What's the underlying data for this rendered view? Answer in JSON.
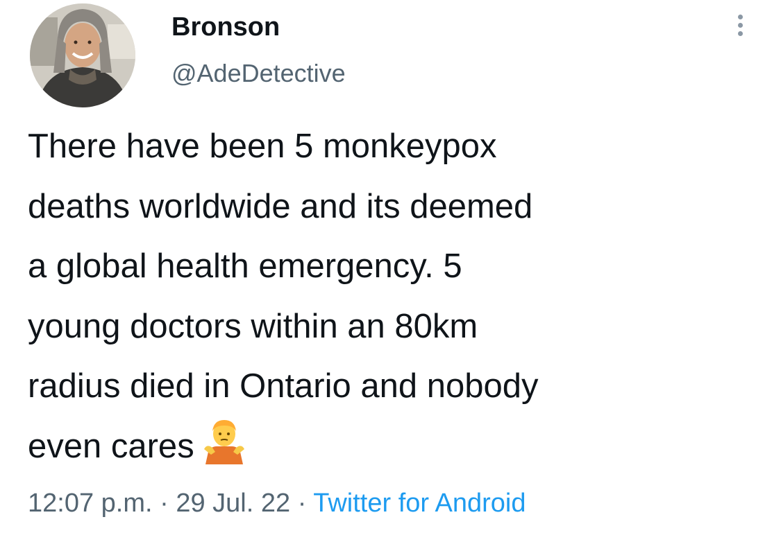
{
  "user": {
    "display_name": "Bronson",
    "handle": "@AdeDetective"
  },
  "tweet": {
    "lines": [
      "There have been 5 monkeypox",
      "deaths worldwide and its deemed",
      "a global health emergency.  5",
      "young doctors within an 80km",
      "radius died in Ontario and nobody",
      "even cares"
    ],
    "emoji": "person-shrugging-icon"
  },
  "meta": {
    "time": "12:07 p.m.",
    "separator": " · ",
    "date": "29 Jul. 22",
    "source": "Twitter for Android"
  },
  "colors": {
    "text": "#0f1419",
    "secondary": "#536471",
    "link": "#1d9bf0"
  }
}
